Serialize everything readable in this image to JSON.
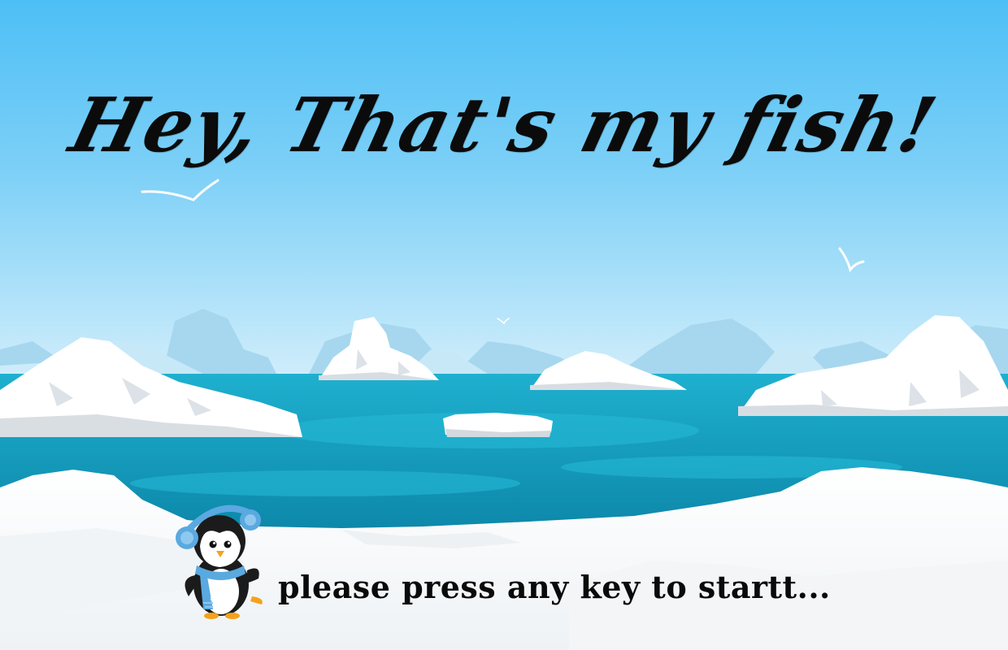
{
  "game": {
    "title": "Hey, That's my fish!",
    "start_prompt": "please press any key to startt..."
  },
  "colors": {
    "sky_top": "#4dbff5",
    "sky_bottom": "#cfeefb",
    "sea": "#1ba8c8",
    "sea_deep": "#0f8fb0",
    "ice": "#ffffff",
    "ice_shadow": "#d7dde2",
    "distant_ice": "#9fd3ee",
    "penguin_scarf": "#5aa9e0"
  },
  "icons": {
    "mascot": "penguin-icon",
    "birds": "seagull-icon"
  }
}
